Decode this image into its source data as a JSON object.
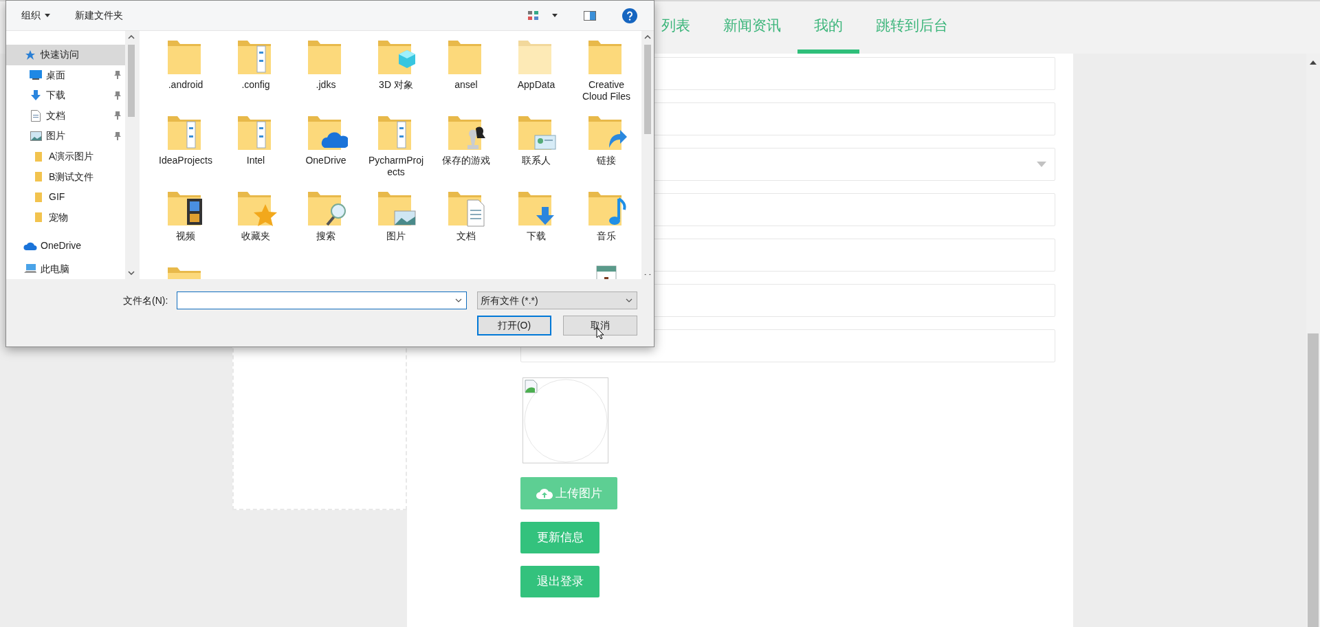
{
  "nav_tabs": [
    {
      "label": "列表",
      "selected": false
    },
    {
      "label": "新闻资讯",
      "selected": false
    },
    {
      "label": "我的",
      "selected": true
    },
    {
      "label": "跳转到后台",
      "selected": false
    }
  ],
  "form": {
    "fields": [
      {
        "kind": "text"
      },
      {
        "kind": "text"
      },
      {
        "kind": "select"
      },
      {
        "kind": "text"
      },
      {
        "kind": "text"
      },
      {
        "kind": "text"
      },
      {
        "kind": "text"
      }
    ],
    "upload_button": "上传图片",
    "buttons": [
      "更新信息",
      "退出登录"
    ]
  },
  "file_dialog": {
    "toolbar": {
      "organize": "组织",
      "new_folder": "新建文件夹"
    },
    "nav_items": [
      {
        "label": "快速访问",
        "kind": "star",
        "selected": true,
        "pinned": false
      },
      {
        "label": "桌面",
        "kind": "desktop",
        "selected": false,
        "pinned": true
      },
      {
        "label": "下载",
        "kind": "download",
        "selected": false,
        "pinned": true
      },
      {
        "label": "文档",
        "kind": "document",
        "selected": false,
        "pinned": true
      },
      {
        "label": "图片",
        "kind": "image",
        "selected": false,
        "pinned": true
      },
      {
        "label": "A演示图片",
        "kind": "folder",
        "selected": false,
        "pinned": false
      },
      {
        "label": "B测试文件",
        "kind": "folder",
        "selected": false,
        "pinned": false
      },
      {
        "label": "GIF",
        "kind": "folder",
        "selected": false,
        "pinned": false
      },
      {
        "label": "宠物",
        "kind": "folder",
        "selected": false,
        "pinned": false
      },
      {
        "label": "OneDrive",
        "kind": "cloud",
        "selected": false,
        "pinned": false
      },
      {
        "label": "此电脑",
        "kind": "computer",
        "selected": false,
        "pinned": false
      }
    ],
    "files": [
      {
        "name": ".android",
        "kind": "folder"
      },
      {
        "name": ".config",
        "kind": "docs"
      },
      {
        "name": ".jdks",
        "kind": "folder"
      },
      {
        "name": "3D 对象",
        "kind": "cube"
      },
      {
        "name": "ansel",
        "kind": "folder"
      },
      {
        "name": "AppData",
        "kind": "faded"
      },
      {
        "name": "Creative Cloud Files",
        "kind": "folder"
      },
      {
        "name": "IdeaProjects",
        "kind": "docs"
      },
      {
        "name": "Intel",
        "kind": "docs"
      },
      {
        "name": "OneDrive",
        "kind": "cloud"
      },
      {
        "name": "PycharmProjects",
        "kind": "docs"
      },
      {
        "name": "保存的游戏",
        "kind": "chess"
      },
      {
        "name": "联系人",
        "kind": "contact"
      },
      {
        "name": "链接",
        "kind": "link"
      },
      {
        "name": "视频",
        "kind": "film"
      },
      {
        "name": "收藏夹",
        "kind": "star"
      },
      {
        "name": "搜索",
        "kind": "search"
      },
      {
        "name": "图片",
        "kind": "image"
      },
      {
        "name": "文档",
        "kind": "document"
      },
      {
        "name": "下载",
        "kind": "download"
      },
      {
        "name": "音乐",
        "kind": "music"
      }
    ],
    "partial_row": [
      {
        "kind": "folder"
      },
      {
        "kind": "blank"
      },
      {
        "kind": "blank"
      },
      {
        "kind": "blank"
      },
      {
        "kind": "blank"
      },
      {
        "kind": "blank"
      },
      {
        "kind": "file"
      }
    ],
    "filename_label": "文件名(N):",
    "filter": "所有文件 (*.*)",
    "open_button": "打开(O)",
    "cancel_button": "取消"
  }
}
